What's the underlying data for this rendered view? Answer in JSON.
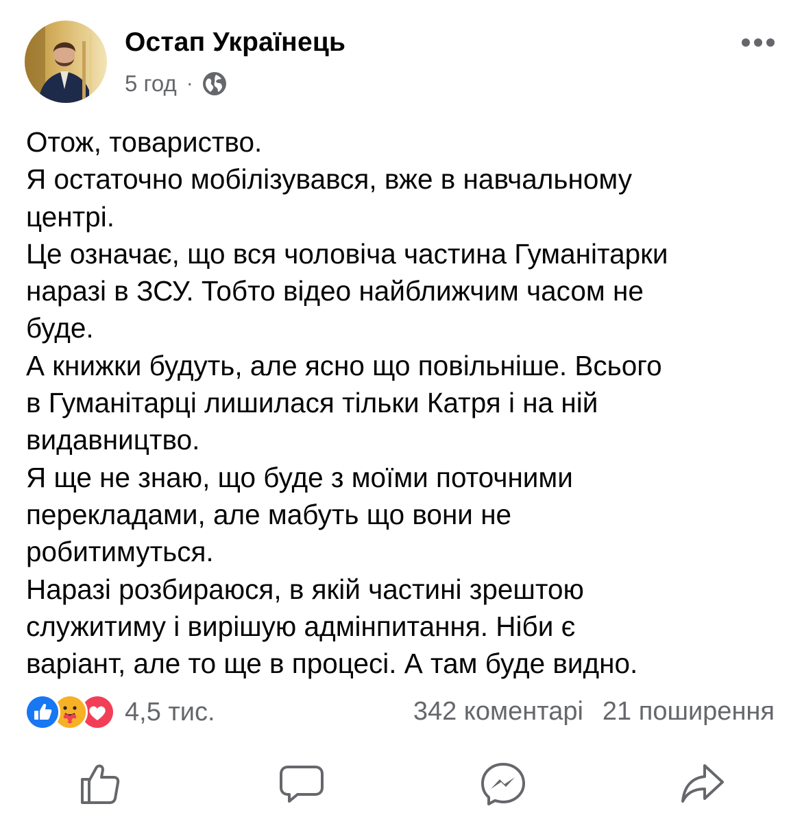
{
  "post": {
    "author": "Остап Українець",
    "time": "5 год",
    "separator": "·",
    "privacy_icon": "globe-icon",
    "more_icon": "more-icon",
    "text_lines": [
      "Отож, товариство.",
      "Я остаточно мобілізувався, вже в навчальному",
      "центрі.",
      "Це означає, що вся чоловіча частина Гуманітарки",
      "наразі в ЗСУ. Тобто відео найближчим часом не",
      "буде.",
      "А книжки будуть, але ясно що повільніше. Всього",
      "в Гуманітарці лишилася тільки Катря і на ній",
      "видавництво.",
      "Я ще не знаю, що буде з моїми поточними",
      "перекладами, але мабуть що вони не",
      "робитимуться.",
      "Наразі розбираюся, в якій частині зрештою",
      "служитиму і вирішую адмінпитання. Ніби є",
      "варіант, але то ще в процесі. А там буде видно."
    ]
  },
  "stats": {
    "reactions": [
      "like",
      "care",
      "love"
    ],
    "reaction_count": "4,5 тис.",
    "comments": "342 коментарі",
    "shares": "21 поширення"
  },
  "actions": [
    {
      "name": "like",
      "icon": "thumbs-up-icon"
    },
    {
      "name": "comment",
      "icon": "comment-icon"
    },
    {
      "name": "send",
      "icon": "messenger-icon"
    },
    {
      "name": "share",
      "icon": "share-icon"
    }
  ],
  "colors": {
    "like_blue": "#1877f2",
    "love_red": "#f33e58",
    "care_yellow": "#f7b125",
    "secondary_text": "#65676b",
    "primary_text": "#050505"
  }
}
